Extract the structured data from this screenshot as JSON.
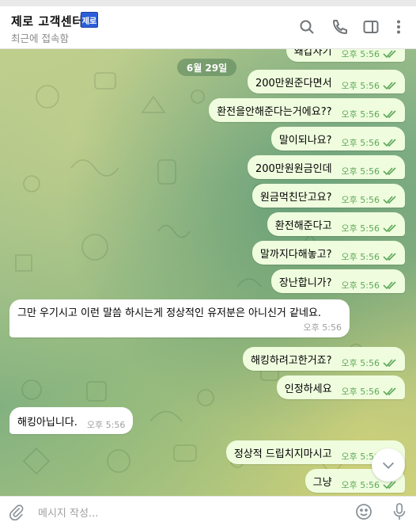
{
  "header": {
    "title": "제로 고객센터",
    "badge": "제로",
    "subtitle": "최근에 접속함"
  },
  "date_pill": "6월 29일",
  "messages": [
    {
      "side": "out",
      "text": "왜갑자기",
      "time": "오후 5:56"
    },
    {
      "side": "out",
      "text": "200만원준다면서",
      "time": "오후 5:56"
    },
    {
      "side": "out",
      "text": "환전을안해준다는거에요??",
      "time": "오후 5:56"
    },
    {
      "side": "out",
      "text": "말이되나요?",
      "time": "오후 5:56"
    },
    {
      "side": "out",
      "text": "200만원원금인데",
      "time": "오후 5:56"
    },
    {
      "side": "out",
      "text": "원금먹친단고요?",
      "time": "오후 5:56"
    },
    {
      "side": "out",
      "text": "환전해준다고",
      "time": "오후 5:56"
    },
    {
      "side": "out",
      "text": "말까지다해놓고?",
      "time": "오후 5:56"
    },
    {
      "side": "out",
      "text": "장난합니가?",
      "time": "오후 5:56"
    },
    {
      "side": "in",
      "text": "그만 우기시고 이런 말씀 하시는게 정상적인 유저분은 아니신거 같네요.",
      "time": "오후 5:56"
    },
    {
      "side": "out",
      "text": "해킹하려고한거죠?",
      "time": "오후 5:56"
    },
    {
      "side": "out",
      "text": "인정하세요",
      "time": "오후 5:56"
    },
    {
      "side": "in",
      "text": "해킹아닙니다.",
      "time": "오후 5:56"
    },
    {
      "side": "out",
      "text": "정상적 드립치지마시고",
      "time": "오후 5:56"
    },
    {
      "side": "out",
      "text": "그냥",
      "time": "오후 5:56"
    }
  ],
  "composer": {
    "placeholder": "메시지 작성..."
  },
  "icons": [
    "search-icon",
    "phone-icon",
    "sidebar-toggle-icon",
    "more-icon",
    "attach-icon",
    "emoji-icon",
    "mic-icon",
    "chevron-down-icon"
  ],
  "colors": {
    "outgoing_bubble": "#effdde",
    "incoming_bubble": "#ffffff",
    "check_color": "#5fa85a",
    "badge": "#2b5fd9"
  }
}
